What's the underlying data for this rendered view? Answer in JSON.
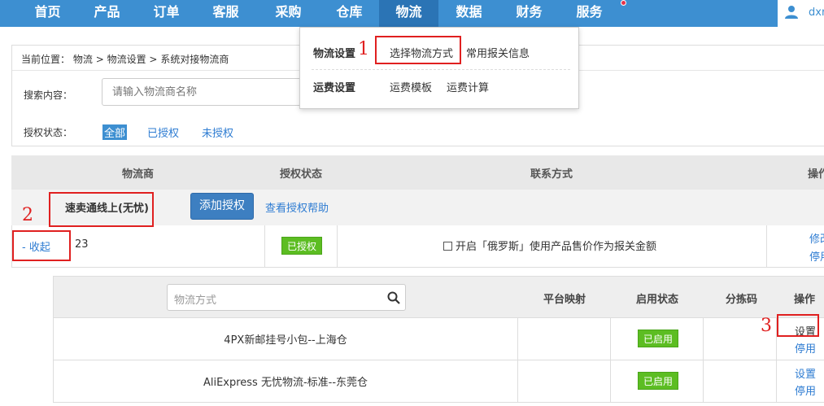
{
  "nav": {
    "items": [
      {
        "label": "首页"
      },
      {
        "label": "产品"
      },
      {
        "label": "订单"
      },
      {
        "label": "客服"
      },
      {
        "label": "采购"
      },
      {
        "label": "仓库"
      },
      {
        "label": "物流"
      },
      {
        "label": "数据"
      },
      {
        "label": "财务"
      },
      {
        "label": "服务"
      }
    ],
    "active": "物流",
    "user": "dxr"
  },
  "dropdown": {
    "group1": {
      "title": "物流设置",
      "links": [
        "选择物流方式",
        "常用报关信息"
      ]
    },
    "group2": {
      "title": "运费设置",
      "links": [
        "运费模板",
        "运费计算"
      ]
    }
  },
  "breadcrumb": {
    "prefix": "当前位置：",
    "items": [
      "物流",
      "物流设置",
      "系统对接物流商"
    ],
    "sep": ">"
  },
  "filter": {
    "search_label": "搜索内容：",
    "search_placeholder": "请输入物流商名称",
    "auth_label": "授权状态：",
    "auth_options": [
      "全部",
      "已授权",
      "未授权"
    ]
  },
  "table": {
    "headers": [
      "物流商",
      "授权状态",
      "联系方式",
      "操作"
    ],
    "provider": {
      "name": "速卖通线上(无忧)",
      "add_button": "添加授权",
      "help_link": "查看授权帮助",
      "collapse": "- 收起",
      "count": "23",
      "status": "已授权",
      "contact": "开启「俄罗斯」使用产品售价作为报关金额",
      "ops": [
        "修改",
        "停用"
      ]
    }
  },
  "subtable": {
    "search_placeholder": "物流方式",
    "headers": [
      "平台映射",
      "启用状态",
      "分拣码",
      "操作"
    ],
    "rows": [
      {
        "name": "4PX新邮挂号小包--上海仓",
        "status": "已启用",
        "ops": [
          "设置",
          "停用"
        ]
      },
      {
        "name": "AliExpress 无忧物流-标准--东莞仓",
        "status": "已启用",
        "ops": [
          "设置",
          "停用"
        ]
      }
    ]
  },
  "annotations": [
    "1",
    "2",
    "3"
  ],
  "colors": {
    "nav_bg": "#3d8fd1",
    "nav_active": "#2b74b5",
    "link": "#2e7cd2",
    "badge_green": "#5cbd22",
    "annotation_red": "#e02020"
  }
}
